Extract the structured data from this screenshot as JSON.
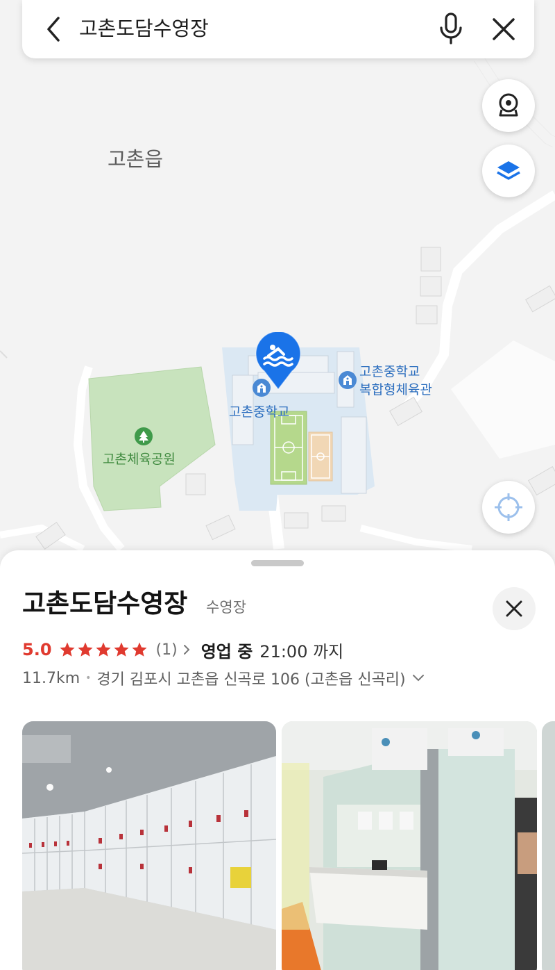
{
  "search": {
    "query": "고촌도담수영장"
  },
  "map": {
    "labels": {
      "town": "고촌읍",
      "park": "고촌체육공원",
      "school": "고촌중학교",
      "gym_line1": "고촌중학교",
      "gym_line2": "복합형체육관"
    },
    "pin_icon": "swimming-icon"
  },
  "place": {
    "name": "고촌도담수영장",
    "category": "수영장",
    "rating": "5.0",
    "stars": 5,
    "review_count": "(1)",
    "open_status": "영업 중",
    "open_until": "21:00 까지",
    "distance": "11.7km",
    "address": "경기 김포시 고촌읍 신곡로 106 (고촌읍 신곡리)"
  },
  "colors": {
    "accent_blue": "#1a73e8",
    "rating_red": "#e03a2f",
    "park_green": "#c8e3bd",
    "school_blue": "#dbe8f3"
  }
}
